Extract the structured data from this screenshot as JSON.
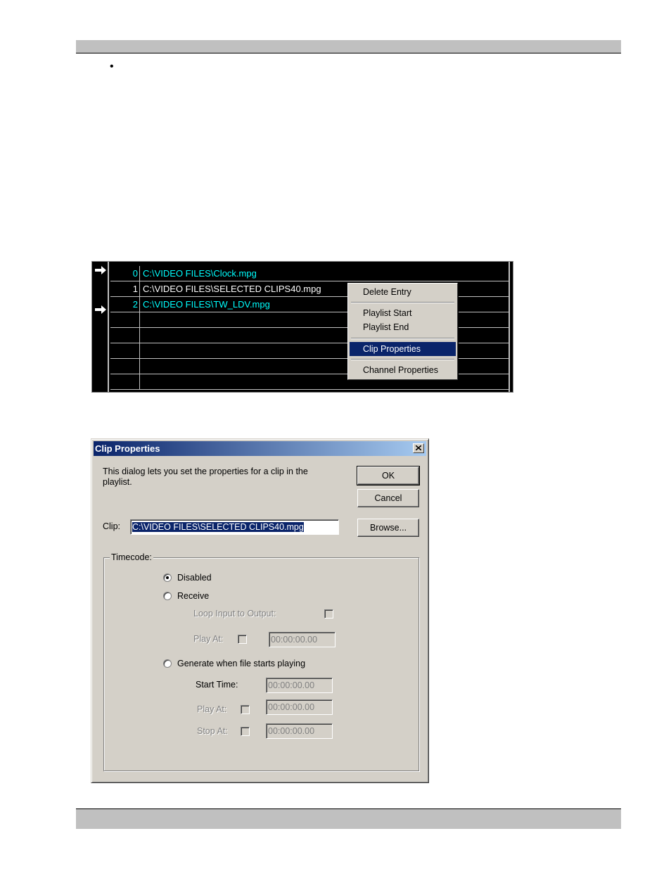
{
  "doc": {
    "bullet": "•"
  },
  "playlist": {
    "rows": [
      {
        "index": "0",
        "path": "C:\\VIDEO FILES\\Clock.mpg",
        "color": "#00ffff",
        "arrow": true
      },
      {
        "index": "1",
        "path": "C:\\VIDEO FILES\\SELECTED CLIPS40.mpg",
        "color": "#ffffff",
        "arrow": false
      },
      {
        "index": "2",
        "path": "C:\\VIDEO FILES\\TW_LDV.mpg",
        "color": "#00ffff",
        "arrow": true
      }
    ],
    "arrow_icon": "right-arrow-icon"
  },
  "context_menu": {
    "delete_entry": "Delete Entry",
    "playlist_start": "Playlist Start",
    "playlist_end": "Playlist End",
    "clip_properties": "Clip Properties",
    "channel_properties": "Channel Properties",
    "selected_color": "#0a246a"
  },
  "dialog": {
    "title": "Clip Properties",
    "close_icon": "close-icon",
    "description": "This dialog lets you set the properties for a clip in the playlist.",
    "ok_label": "OK",
    "cancel_label": "Cancel",
    "browse_label": "Browse...",
    "clip_label": "Clip:",
    "clip_value": "C:\\VIDEO FILES\\SELECTED CLIPS40.mpg",
    "timecode_label": "Timecode:",
    "disabled_label": "Disabled",
    "receive_label": "Receive",
    "loop_label": "Loop Input to Output:",
    "receive_play_at_label": "Play At:",
    "receive_play_at_value": "00:00:00.00",
    "generate_label": "Generate when file starts playing",
    "start_time_label": "Start Time:",
    "start_time_value": "00:00:00.00",
    "gen_play_at_label": "Play At:",
    "gen_play_at_value": "00:00:00.00",
    "stop_at_label": "Stop At:",
    "stop_at_value": "00:00:00.00",
    "titlebar_color": "#0a246a"
  }
}
